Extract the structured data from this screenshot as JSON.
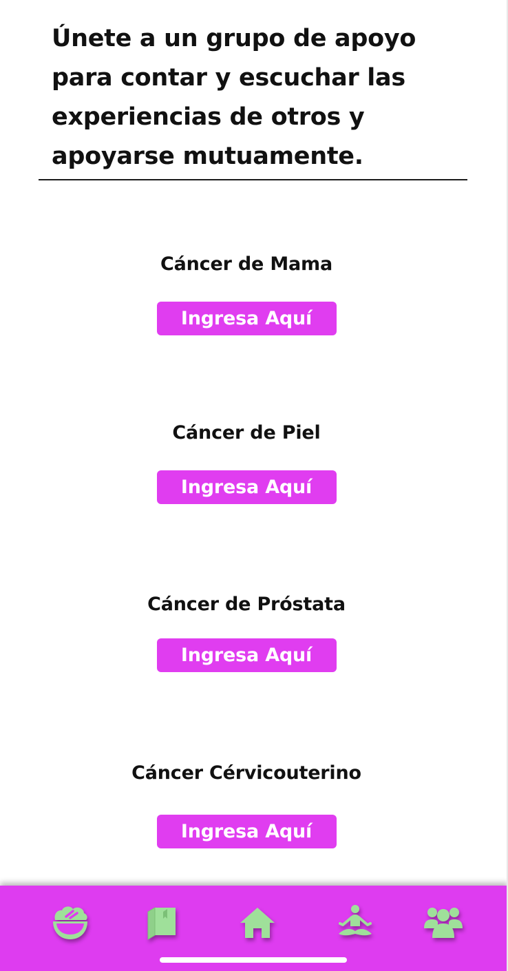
{
  "header": {
    "intro_text": "Únete a un grupo de apoyo para contar y escuchar las experiencias de otros y apoyarse mutuamente."
  },
  "groups": [
    {
      "title": "Cáncer de Mama",
      "button_label": "Ingresa Aquí"
    },
    {
      "title": "Cáncer de Piel",
      "button_label": "Ingresa Aquí"
    },
    {
      "title": "Cáncer de Próstata",
      "button_label": "Ingresa Aquí"
    },
    {
      "title": "Cáncer Cérvicouterino",
      "button_label": "Ingresa Aquí"
    }
  ],
  "bottom_nav": {
    "items": [
      {
        "icon": "salad-bowl-icon"
      },
      {
        "icon": "book-icon"
      },
      {
        "icon": "home-icon"
      },
      {
        "icon": "meditation-icon"
      },
      {
        "icon": "group-icon"
      }
    ]
  },
  "colors": {
    "accent": "#e03df0",
    "nav_background": "#de3cf0",
    "nav_icon": "#9fe09a",
    "text": "#111111",
    "button_text": "#ffffff"
  }
}
